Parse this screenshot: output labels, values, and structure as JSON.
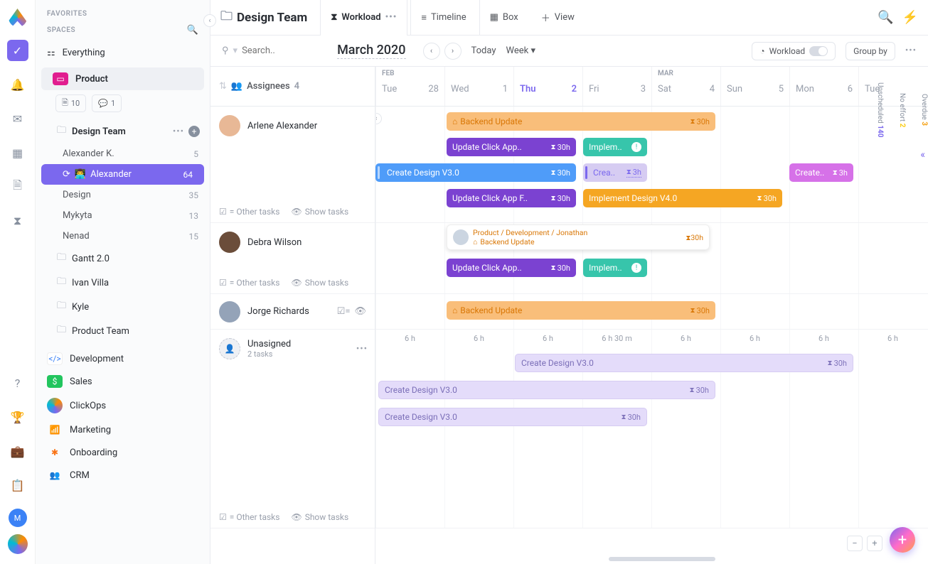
{
  "sidebar": {
    "favorites_label": "FAVORITES",
    "spaces_label": "SPACES",
    "everything": "Everything",
    "product_label": "Product",
    "chips": {
      "docs": "10",
      "chat": "1"
    },
    "design_team": "Design Team",
    "members": [
      {
        "name": "Alexander K.",
        "count": "5"
      },
      {
        "name": "Alexander",
        "count": "64",
        "active": true,
        "icon": "👨‍💻"
      },
      {
        "name": "Design",
        "count": "35"
      },
      {
        "name": "Mykyta",
        "count": "13"
      },
      {
        "name": "Nenad",
        "count": "15"
      }
    ],
    "folders": [
      "Gantt 2.0",
      "Ivan Villa",
      "Kyle",
      "Product Team"
    ],
    "spaces": [
      {
        "name": "Development",
        "color": "#fff",
        "fg": "#3b82f6",
        "icon": "</>"
      },
      {
        "name": "Sales",
        "color": "#22c55e",
        "icon": "$"
      },
      {
        "name": "ClickOps",
        "color": "transparent",
        "icon": "◌",
        "logo": true
      },
      {
        "name": "Marketing",
        "color": "#ef4444",
        "icon": "📶"
      },
      {
        "name": "Onboarding",
        "color": "#f97316",
        "icon": "✱"
      },
      {
        "name": "CRM",
        "color": "#3b82f6",
        "icon": "👥"
      }
    ]
  },
  "header": {
    "breadcrumb": "Design Team",
    "tabs": {
      "workload": "Workload",
      "timeline": "Timeline",
      "box": "Box",
      "addview": "View"
    }
  },
  "toolbar": {
    "search_placeholder": "Search..",
    "month": "March 2020",
    "today": "Today",
    "range": "Week",
    "workload": "Workload",
    "groupby": "Group by"
  },
  "calendar": {
    "months": {
      "feb": "FEB",
      "mar": "MAR"
    },
    "days": [
      {
        "dow": "Tue",
        "num": "28"
      },
      {
        "dow": "Wed",
        "num": "1"
      },
      {
        "dow": "Thu",
        "num": "2",
        "current": true
      },
      {
        "dow": "Fri",
        "num": "3"
      },
      {
        "dow": "Sat",
        "num": "4"
      },
      {
        "dow": "Sun",
        "num": "5"
      },
      {
        "dow": "Mon",
        "num": "6"
      },
      {
        "dow": "Tue",
        "num": ""
      }
    ]
  },
  "assignees": {
    "label": "Assignees",
    "count": "4",
    "other_tasks": "= Other tasks",
    "show_tasks": "Show tasks",
    "rows": [
      {
        "name": "Arlene Alexander",
        "avatar": "#e8b896"
      },
      {
        "name": "Debra Wilson",
        "avatar": "#6b4d3a"
      },
      {
        "name": "Jorge Richards",
        "avatar": "#94a3b8"
      },
      {
        "name": "Unasigned",
        "sub": "2 tasks",
        "placeholder": true
      }
    ]
  },
  "tasks": {
    "backend_update": "Backend Update",
    "update_click_app": "Update Click App..",
    "update_click_app_f": "Update Click App F..",
    "implem": "Implem..",
    "implement_v4": "Implement Design V4.0",
    "create_v3": "Create Design V3.0",
    "crea": "Crea..",
    "create_short": "Create..",
    "time30": "30h",
    "time3": "3h",
    "tooltip_path": "Product / Development / Jonathan",
    "tooltip_title": "Backend Update"
  },
  "hours": [
    "6 h",
    "6 h",
    "6 h",
    "6 h 30 m",
    "6 h",
    "6 h",
    "6 h",
    "6 h"
  ],
  "ribbon": {
    "overdue": {
      "n": "3",
      "t": "Overdue"
    },
    "noeffort": {
      "n": "2",
      "t": "No effort"
    },
    "unscheduled": {
      "n": "140",
      "t": "Unscheduled"
    }
  }
}
